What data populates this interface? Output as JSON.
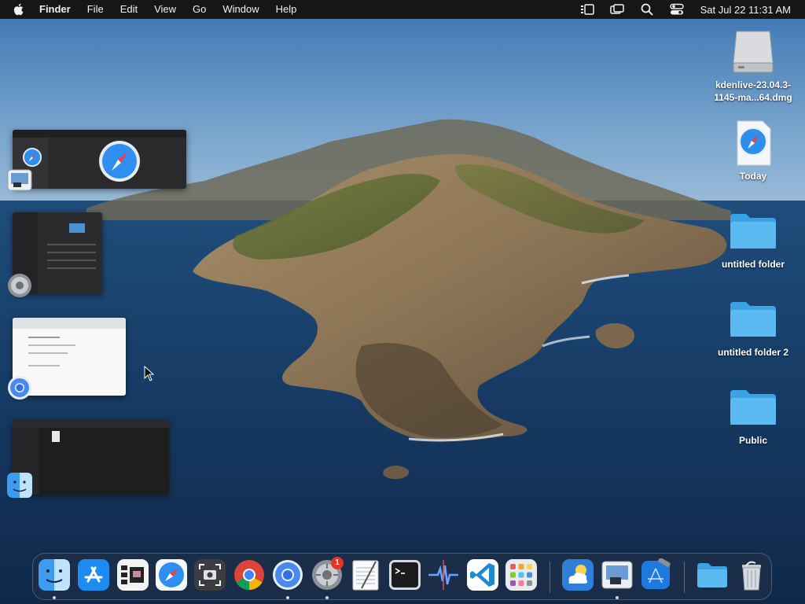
{
  "menubar": {
    "apple_icon": "apple-logo-icon",
    "app_name": "Finder",
    "menus": [
      "File",
      "Edit",
      "View",
      "Go",
      "Window",
      "Help"
    ],
    "status_icons": [
      "stage-manager-icon",
      "screen-mirroring-icon",
      "spotlight-search-icon",
      "control-center-icon"
    ],
    "clock": "Sat Jul 22  11:31 AM"
  },
  "desktop": {
    "icons": [
      {
        "label": "kdenlive-23.04.3-1145-ma...64.dmg",
        "icon": "disk-image-icon"
      },
      {
        "label": "Today",
        "icon": "safari-document-icon"
      },
      {
        "label": "untitled folder",
        "icon": "folder-icon"
      },
      {
        "label": "untitled folder 2",
        "icon": "folder-icon"
      },
      {
        "label": "Public",
        "icon": "folder-icon"
      }
    ]
  },
  "stage_manager": {
    "groups": [
      {
        "app": "Preview / Safari",
        "badge_icon": "preview-icon"
      },
      {
        "app": "System Settings",
        "badge_icon": "system-settings-icon"
      },
      {
        "app": "Chromium",
        "badge_icon": "chromium-icon"
      },
      {
        "app": "Finder",
        "badge_icon": "finder-icon"
      }
    ]
  },
  "dock": {
    "items": [
      {
        "name": "Finder",
        "icon": "finder-icon",
        "running": true
      },
      {
        "name": "App Store",
        "icon": "app-store-icon",
        "running": false
      },
      {
        "name": "Stage Manager",
        "icon": "stage-manager-app-icon",
        "running": false
      },
      {
        "name": "Safari",
        "icon": "safari-icon",
        "running": false
      },
      {
        "name": "Screenshot",
        "icon": "screenshot-icon",
        "running": false
      },
      {
        "name": "Google Chrome",
        "icon": "chrome-icon",
        "running": false
      },
      {
        "name": "Chromium",
        "icon": "chromium-icon",
        "running": true
      },
      {
        "name": "System Settings",
        "icon": "system-settings-icon",
        "running": true,
        "badge": "1"
      },
      {
        "name": "TextEdit",
        "icon": "textedit-icon",
        "running": false
      },
      {
        "name": "Terminal",
        "icon": "terminal-icon",
        "running": false
      },
      {
        "name": "Instruments",
        "icon": "instruments-icon",
        "running": false
      },
      {
        "name": "Visual Studio Code",
        "icon": "vscode-icon",
        "running": false
      },
      {
        "name": "Launchpad",
        "icon": "launchpad-icon",
        "running": false
      },
      {
        "name": "Weather",
        "icon": "weather-icon",
        "running": false
      },
      {
        "name": "Preview",
        "icon": "preview-icon",
        "running": true
      },
      {
        "name": "Xcode",
        "icon": "xcode-icon",
        "running": false
      },
      {
        "name": "Downloads",
        "icon": "downloads-folder-icon",
        "running": false
      },
      {
        "name": "Trash",
        "icon": "trash-icon",
        "running": false
      }
    ]
  }
}
